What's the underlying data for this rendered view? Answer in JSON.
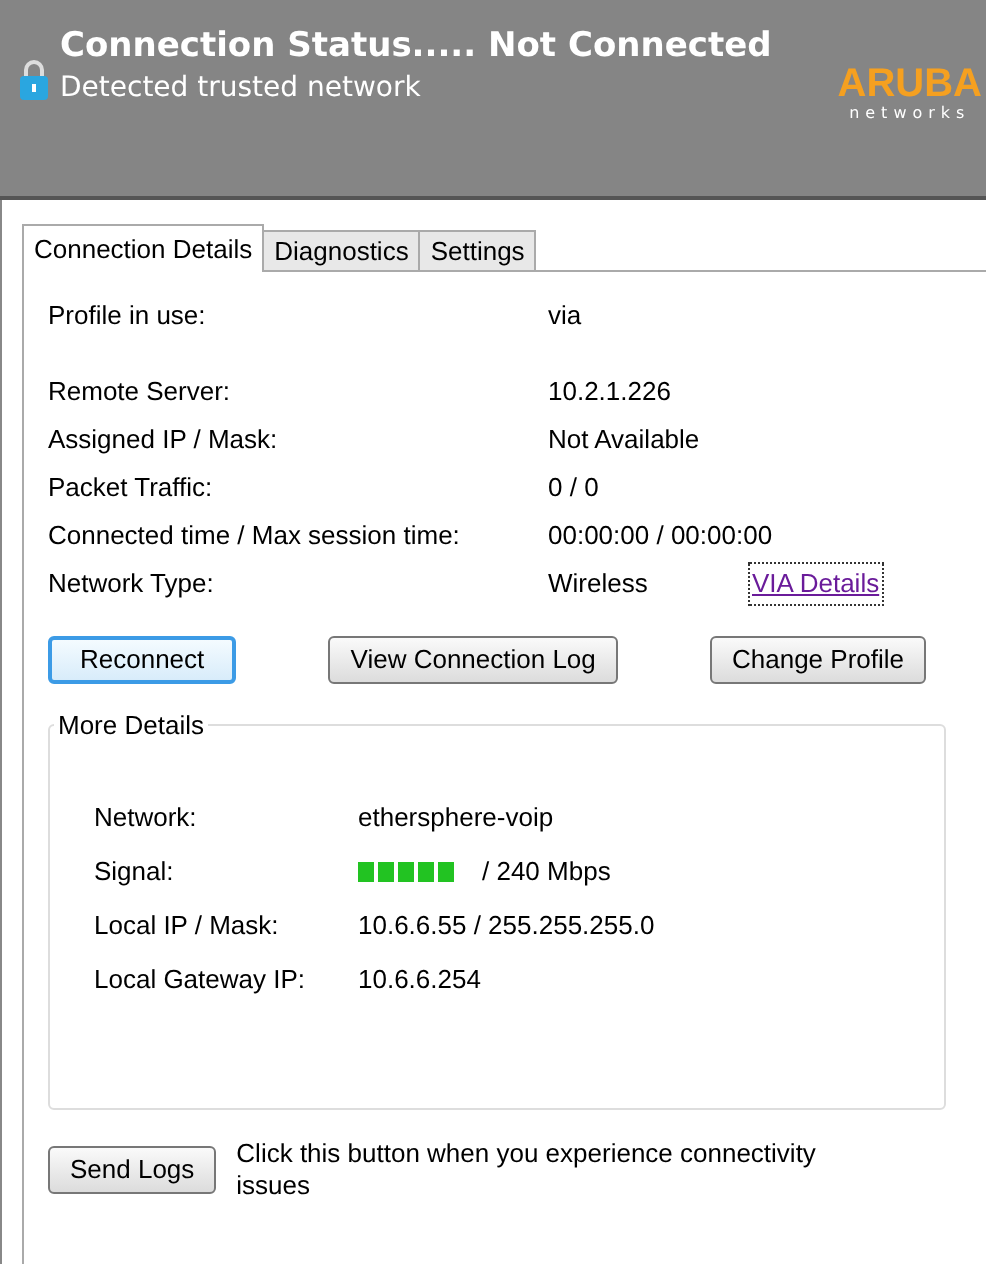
{
  "header": {
    "title": "Connection Status..... Not Connected",
    "subtitle": "Detected trusted network",
    "logo": {
      "name": "ARUBA",
      "tagline": "networks"
    }
  },
  "tabs": [
    {
      "label": "Connection Details",
      "selected": true
    },
    {
      "label": "Diagnostics",
      "selected": false
    },
    {
      "label": "Settings",
      "selected": false
    }
  ],
  "details": [
    {
      "label": "Profile in use:",
      "value": "via"
    },
    {
      "label": "Remote Server:",
      "value": "10.2.1.226"
    },
    {
      "label": "Assigned IP / Mask:",
      "value": "Not Available"
    },
    {
      "label": "Packet Traffic:",
      "value": "0 / 0"
    },
    {
      "label": "Connected time / Max session time:",
      "value": "00:00:00 / 00:00:00"
    },
    {
      "label": "Network Type:",
      "value": "Wireless",
      "link": "VIA Details"
    }
  ],
  "buttons": [
    {
      "label": "Reconnect",
      "selected": true
    },
    {
      "label": "View Connection Log",
      "selected": false
    },
    {
      "label": "Change Profile",
      "selected": false
    }
  ],
  "more_details": {
    "title": "More Details",
    "rows": [
      {
        "kind": "text",
        "label": "Network:",
        "value": "ethersphere-voip"
      },
      {
        "kind": "signal",
        "label": "Signal:",
        "value": "/ 240 Mbps"
      },
      {
        "kind": "text",
        "label": "Local IP / Mask:",
        "value": "10.6.6.55 / 255.255.255.0"
      },
      {
        "kind": "text",
        "label": "Local Gateway IP:",
        "value": "10.6.6.254"
      }
    ]
  },
  "send_logs": {
    "button": "Send Logs",
    "hint": "Click this button when you experience connectivity issues"
  }
}
